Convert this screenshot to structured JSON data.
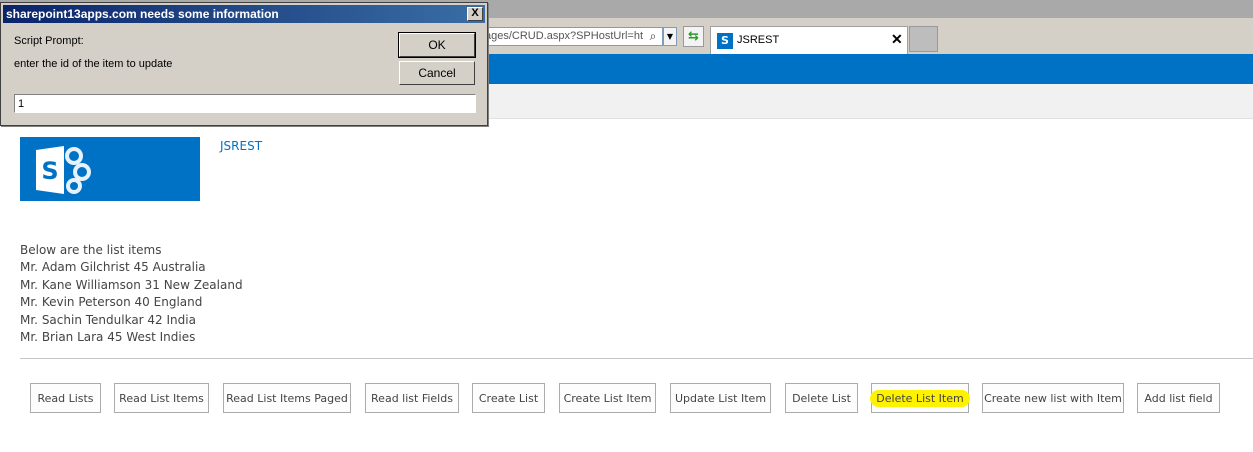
{
  "browser": {
    "address_text": "ages/CRUD.aspx?SPHostUrl=ht",
    "tab_title": "JSREST",
    "tab_close_glyph": "✕",
    "favicon_letter": "S"
  },
  "site": {
    "title": "JSREST",
    "logo_letter": "S",
    "brand_color": "#0072c6"
  },
  "list": {
    "heading": "Below are the list items",
    "items": [
      "Mr. Adam Gilchrist 45 Australia",
      "Mr. Kane Williamson 31 New Zealand",
      "Mr. Kevin Peterson 40 England",
      "Mr. Sachin Tendulkar 42 India",
      "Mr. Brian Lara 45 West Indies"
    ]
  },
  "buttons": [
    "Read Lists",
    "Read List Items",
    "Read List Items Paged",
    "Read list Fields",
    "Create List",
    "Create List Item",
    "Update List Item",
    "Delete List",
    "Delete List Item",
    "Create new list with Item",
    "Add list field"
  ],
  "highlight_color": "#fff200",
  "dialog": {
    "title": "sharepoint13apps.com needs some information",
    "close_glyph": "X",
    "prompt_label": "Script Prompt:",
    "message": "enter the id of the item to update",
    "ok_label": "OK",
    "cancel_label": "Cancel",
    "input_value": "1"
  }
}
